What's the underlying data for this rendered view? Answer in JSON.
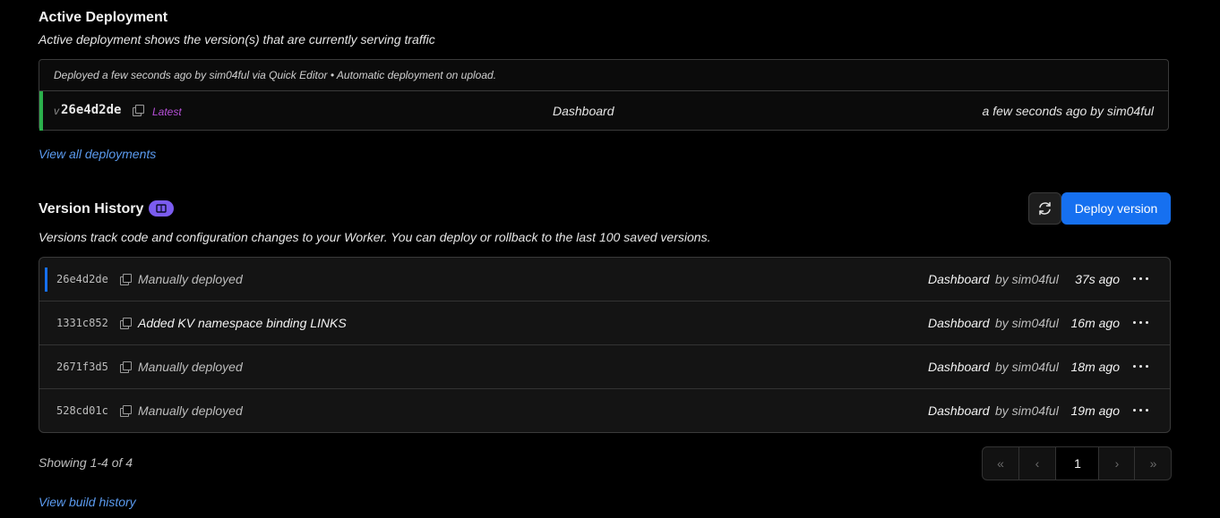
{
  "active": {
    "title": "Active Deployment",
    "subtitle": "Active deployment shows the version(s) that are currently serving traffic",
    "info": "Deployed a few seconds ago by sim04ful via Quick Editor • Automatic deployment on upload.",
    "version_prefix": "v",
    "version_id": "26e4d2de",
    "latest_label": "Latest",
    "source": "Dashboard",
    "when": "a few seconds ago by sim04ful",
    "view_all_link": "View all deployments"
  },
  "history": {
    "title": "Version History",
    "subtitle": "Versions track code and configuration changes to your Worker. You can deploy or rollback to the last 100 saved versions.",
    "deploy_button": "Deploy version",
    "rows": [
      {
        "id": "26e4d2de",
        "message": "Manually deployed",
        "source": "Dashboard",
        "by": "by sim04ful",
        "time": "37s ago"
      },
      {
        "id": "1331c852",
        "message": "Added KV namespace binding LINKS",
        "source": "Dashboard",
        "by": "by sim04ful",
        "time": "16m ago"
      },
      {
        "id": "2671f3d5",
        "message": "Manually deployed",
        "source": "Dashboard",
        "by": "by sim04ful",
        "time": "18m ago"
      },
      {
        "id": "528cd01c",
        "message": "Manually deployed",
        "source": "Dashboard",
        "by": "by sim04ful",
        "time": "19m ago"
      }
    ],
    "showing": "Showing 1-4 of 4",
    "pagination": {
      "first": "«",
      "prev": "‹",
      "current": "1",
      "next": "›",
      "last": "»"
    },
    "build_history_link": "View build history"
  },
  "colors": {
    "active_bar": "#2bb04c",
    "current_bar": "#1670f0",
    "latest_text": "#b54fd6",
    "badge": "#7b5cf0",
    "deploy_button": "#1670f0"
  }
}
